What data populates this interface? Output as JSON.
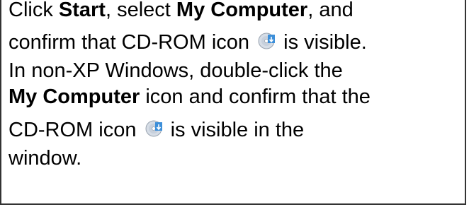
{
  "instructions": {
    "l1_a": "Click ",
    "l1_b": "Start",
    "l1_c": ", select ",
    "l1_d": "My Computer",
    "l1_e": ", and",
    "l2_a": "confirm that CD-ROM icon ",
    "l2_b": " is visible.",
    "l3": "In non-XP Windows, double-click the",
    "l4_a": "My Computer",
    "l4_b": " icon and confirm that the",
    "l5_a": "CD-ROM icon ",
    "l5_b": " is visible in the",
    "l6": "window."
  },
  "icons": {
    "cdrom": "cd-rom-icon"
  }
}
